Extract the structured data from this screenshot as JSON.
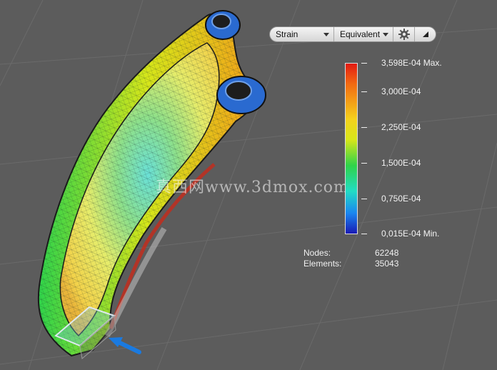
{
  "toolbar": {
    "result_type": "Strain",
    "component": "Equivalent",
    "settings_icon": "gear-icon",
    "collapse_icon": "triangle-icon"
  },
  "legend": {
    "max_label": "3,598E-04 Max.",
    "ticks": [
      "3,000E-04",
      "2,250E-04",
      "1,500E-04",
      "0,750E-04"
    ],
    "min_label": "0,015E-04 Min.",
    "colors": [
      "#e21a12",
      "#f4d21c",
      "#2fd34a",
      "#22dcc4",
      "#1a86f0",
      "#1a1ab4"
    ]
  },
  "mesh_info": {
    "nodes_label": "Nodes:",
    "nodes_value": "62248",
    "elements_label": "Elements:",
    "elements_value": "35043"
  },
  "watermark": "真西网www.3dmox.com"
}
